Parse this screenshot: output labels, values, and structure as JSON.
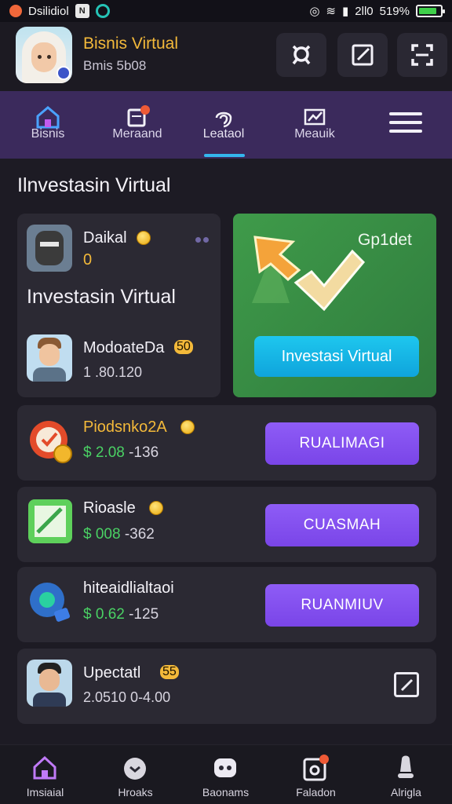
{
  "status_bar": {
    "carrier": "Dsilidiol",
    "time_text": "2ll0",
    "battery_text": "519%",
    "battery_level": 0.85
  },
  "header": {
    "title": "Bisnis Virtual",
    "subtitle": "Bmis 5b08"
  },
  "topnav": {
    "items": [
      {
        "label": "Bisnis"
      },
      {
        "label": "Meraand"
      },
      {
        "label": "Leataol"
      },
      {
        "label": "Meauik"
      }
    ],
    "active_index": 2
  },
  "section_title": "Ilnvestasin Virtual",
  "left_card": {
    "user_name": "Daikal",
    "user_value": "0",
    "headline": "Investasin Virtual",
    "second_name": "ModoateDa",
    "second_badge": "50",
    "second_value": "1 .80.120"
  },
  "green_card": {
    "label": "Gp1det",
    "button_label": "Investasi Virtual"
  },
  "rows": [
    {
      "title": "Piodsnko2A",
      "value": "$ 2.08",
      "value_tail": " -136",
      "button": "RUALIMAGI"
    },
    {
      "title": "Rioasle",
      "value": "$ 008",
      "value_tail": " -362",
      "button": "CUASMAH"
    },
    {
      "title": "hiteaidlialtaoi",
      "value": "$ 0.62",
      "value_tail": " -125",
      "button": "RUANMIUV"
    }
  ],
  "last_row": {
    "title": "Upectatl",
    "badge": "55",
    "value": "2.0510 0-4.00"
  },
  "bottomnav": {
    "items": [
      {
        "label": "Imsiaial"
      },
      {
        "label": "Hroaks"
      },
      {
        "label": "Baonams"
      },
      {
        "label": "Faladon"
      },
      {
        "label": "Alrigla"
      }
    ]
  },
  "colors": {
    "accent_purple": "#8e5cf6",
    "title_gold": "#f3b93a",
    "value_green": "#4ad164",
    "cta_blue": "#1ec7ee"
  }
}
